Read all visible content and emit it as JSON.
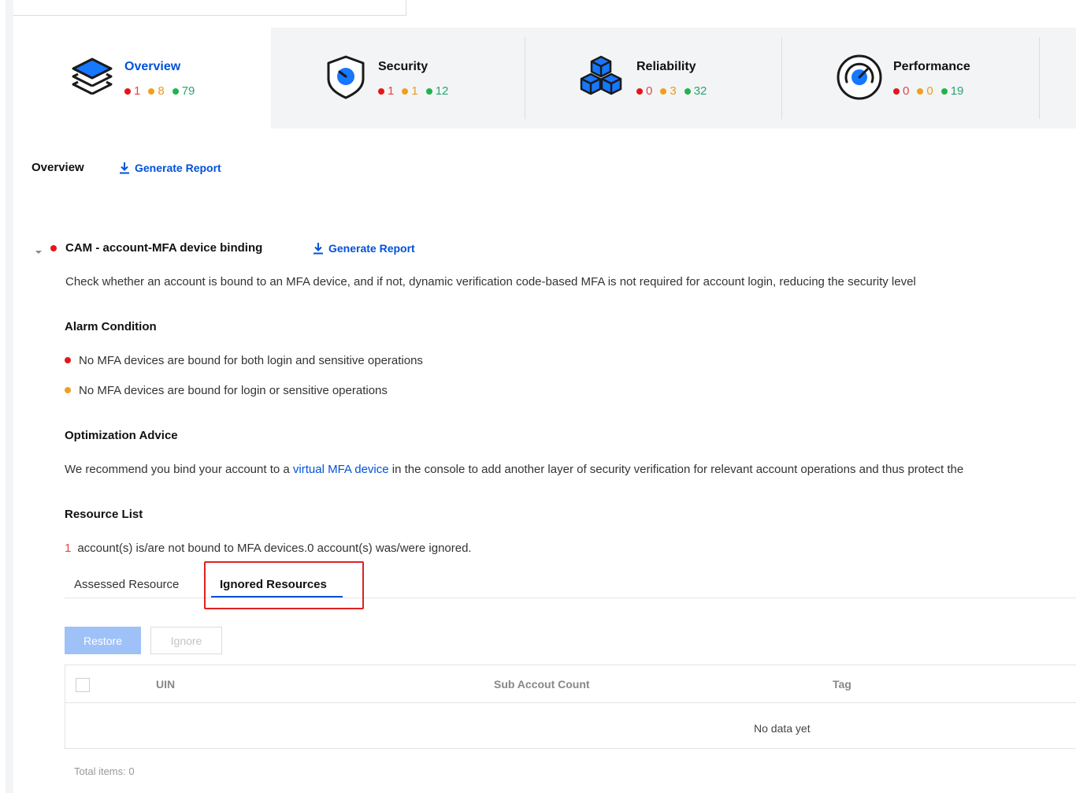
{
  "cards": [
    {
      "id": "overview",
      "title": "Overview",
      "icon": "layers-icon",
      "counts": {
        "red": "1",
        "orange": "8",
        "green": "79"
      }
    },
    {
      "id": "security",
      "title": "Security",
      "icon": "shield-icon",
      "counts": {
        "red": "1",
        "orange": "1",
        "green": "12"
      }
    },
    {
      "id": "reliability",
      "title": "Reliability",
      "icon": "cubes-icon",
      "counts": {
        "red": "0",
        "orange": "3",
        "green": "32"
      }
    },
    {
      "id": "performance",
      "title": "Performance",
      "icon": "gauge-icon",
      "counts": {
        "red": "0",
        "orange": "0",
        "green": "19"
      }
    }
  ],
  "overview_bar": {
    "label": "Overview",
    "generate_report": "Generate Report"
  },
  "item": {
    "title": "CAM - account-MFA device binding",
    "generate_report": "Generate Report",
    "description": "Check whether an account is bound to an MFA device, and if not, dynamic verification code-based MFA is not required for account login, reducing the security level",
    "alarm_title": "Alarm Condition",
    "alarm_red": "No MFA devices are bound for both login and sensitive operations",
    "alarm_orange": "No MFA devices are bound for login or sensitive operations",
    "advice_title": "Optimization Advice",
    "advice_before": "We recommend you bind your account to a ",
    "advice_link": "virtual MFA device",
    "advice_after": " in the console to add another layer of security verification for relevant account operations and thus protect the",
    "resource_title": "Resource List",
    "resource_count": "1",
    "resource_summary": "account(s) is/are not bound to MFA devices.0  account(s) was/were ignored."
  },
  "tabs": {
    "assessed": "Assessed Resource",
    "ignored": "Ignored Resources"
  },
  "buttons": {
    "restore": "Restore",
    "ignore": "Ignore"
  },
  "table": {
    "columns": {
      "uin": "UIN",
      "sub_count": "Sub Accout Count",
      "tag": "Tag"
    },
    "empty": "No data yet"
  },
  "footer": {
    "total": "Total items: 0"
  },
  "colors": {
    "accent": "#0052d9",
    "red": "#e5151a",
    "orange": "#f0a020",
    "green": "#24b24d",
    "highlight": "#e02020"
  }
}
